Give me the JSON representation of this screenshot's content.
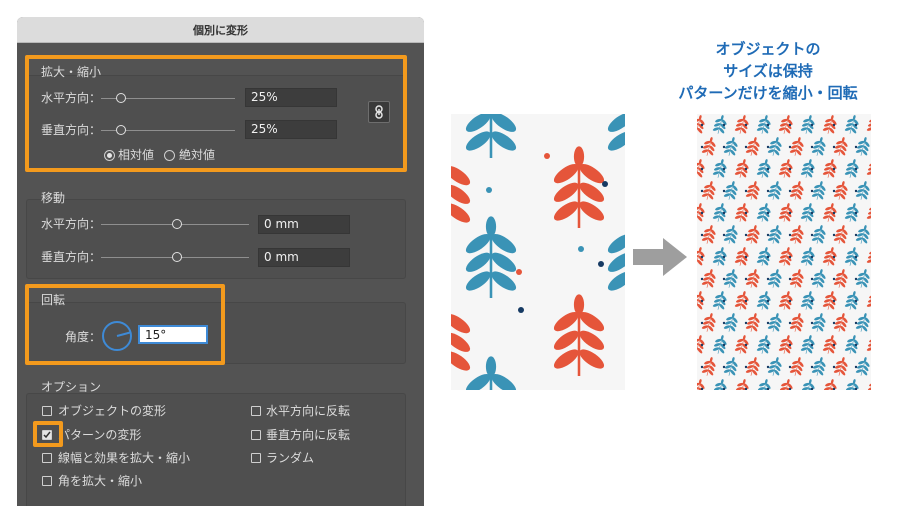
{
  "dialog": {
    "title": "個別に変形",
    "scale": {
      "section_label": "拡大・縮小",
      "horizontal_label": "水平方向：",
      "horizontal_value": "25%",
      "vertical_label": "垂直方向：",
      "vertical_value": "25%",
      "relative_label": "相対値",
      "absolute_label": "絶対値",
      "selected_mode": "相対値"
    },
    "move": {
      "section_label": "移動",
      "horizontal_label": "水平方向：",
      "horizontal_value": "0 mm",
      "vertical_label": "垂直方向：",
      "vertical_value": "0 mm"
    },
    "rotate": {
      "section_label": "回転",
      "angle_label": "角度：",
      "angle_value": "15°"
    },
    "options": {
      "section_label": "オプション",
      "items": [
        {
          "label": "オブジェクトの変形",
          "checked": false
        },
        {
          "label": "パターンの変形",
          "checked": true
        },
        {
          "label": "線幅と効果を拡大・縮小",
          "checked": false
        },
        {
          "label": "角を拡大・縮小",
          "checked": false
        },
        {
          "label": "水平方向に反転",
          "checked": false
        },
        {
          "label": "垂直方向に反転",
          "checked": false
        },
        {
          "label": "ランダム",
          "checked": false
        }
      ]
    }
  },
  "caption": {
    "line1": "オブジェクトの",
    "line2": "サイズは保持",
    "line3": "パターンだけを縮小・回転"
  },
  "colors": {
    "accent_orange": "#f39a1d",
    "leaf_blue": "#3a93b6",
    "leaf_red": "#e5553a",
    "dot_navy": "#163a63",
    "caption_blue": "#1f6bb6",
    "arrow_gray": "#9e9e9e"
  },
  "icons": {
    "link": "chain-link-icon",
    "arrow": "right-arrow-icon",
    "angle": "angle-dial-icon"
  }
}
